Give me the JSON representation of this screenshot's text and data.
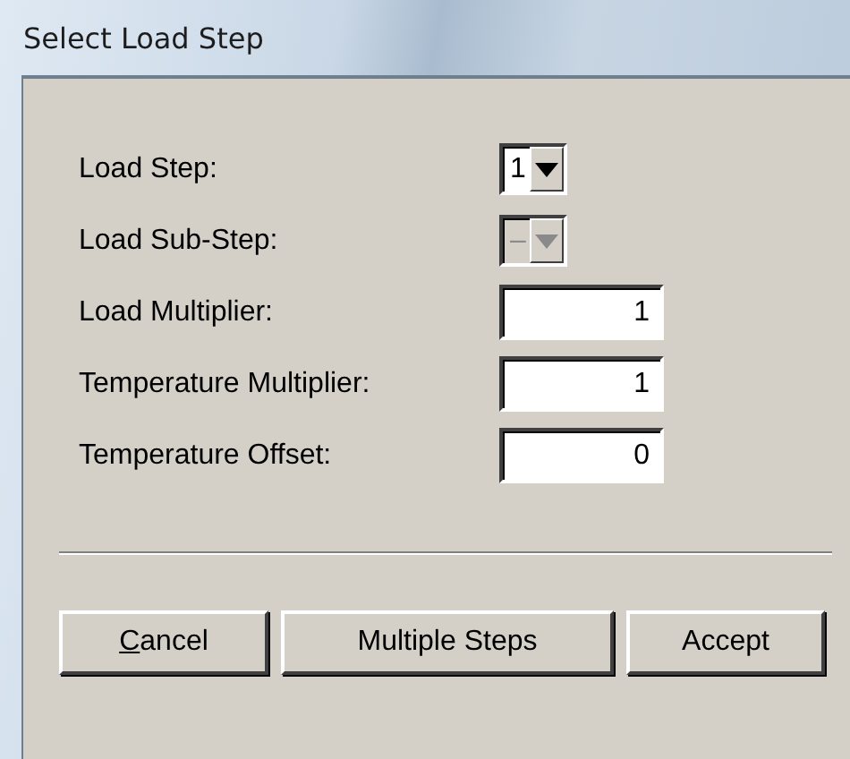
{
  "window": {
    "title": "Select Load Step"
  },
  "fields": [
    {
      "label": "Load Step:",
      "kind": "dropdown",
      "value": "1",
      "disabled": false
    },
    {
      "label": "Load Sub-Step:",
      "kind": "dropdown",
      "value": "–",
      "disabled": true
    },
    {
      "label": "Load Multiplier:",
      "kind": "textbox",
      "value": "1",
      "disabled": false
    },
    {
      "label": "Temperature Multiplier:",
      "kind": "textbox",
      "value": "1",
      "disabled": false
    },
    {
      "label": "Temperature Offset:",
      "kind": "textbox",
      "value": "0",
      "disabled": false
    }
  ],
  "buttons": [
    {
      "label": "Cancel",
      "access_key_underlined": true
    },
    {
      "label": "Multiple Steps"
    },
    {
      "label": "Accept"
    }
  ]
}
